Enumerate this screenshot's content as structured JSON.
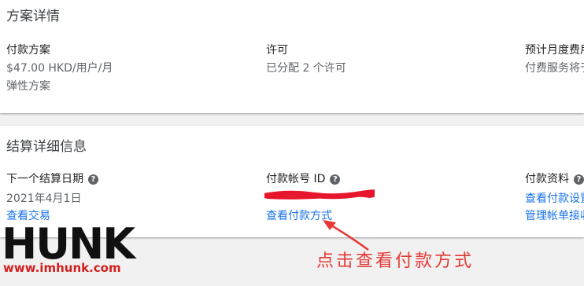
{
  "plan_card": {
    "title": "方案详情",
    "payment_plan_label": "付款方案",
    "price": "$47.00 HKD/用户/月",
    "plan_type": "弹性方案",
    "licenses_label": "许可",
    "licenses_value": "已分配 2 个许可",
    "monthly_cost_label": "预计月度费用",
    "monthly_cost_value": "付费服务将于"
  },
  "billing_card": {
    "title": "结算详细信息",
    "next_billing_label": "下一个结算日期",
    "next_billing_date": "2021年4月1日",
    "view_transactions": "查看交易",
    "payment_account_label": "付款帐号 ID",
    "view_payment_method": "查看付款方式",
    "payment_profile_label": "付款资料",
    "view_payment_settings": "查看付款设置",
    "manage_recipients": "管理帐单接收"
  },
  "help_icon_glyph": "?",
  "watermark": {
    "brand": "HUNK",
    "url": "www.imhunk.com"
  },
  "annotation": "点击查看付款方式",
  "colors": {
    "link": "#1a73e8",
    "annotation": "#e53935",
    "redaction": "#e8162c"
  }
}
